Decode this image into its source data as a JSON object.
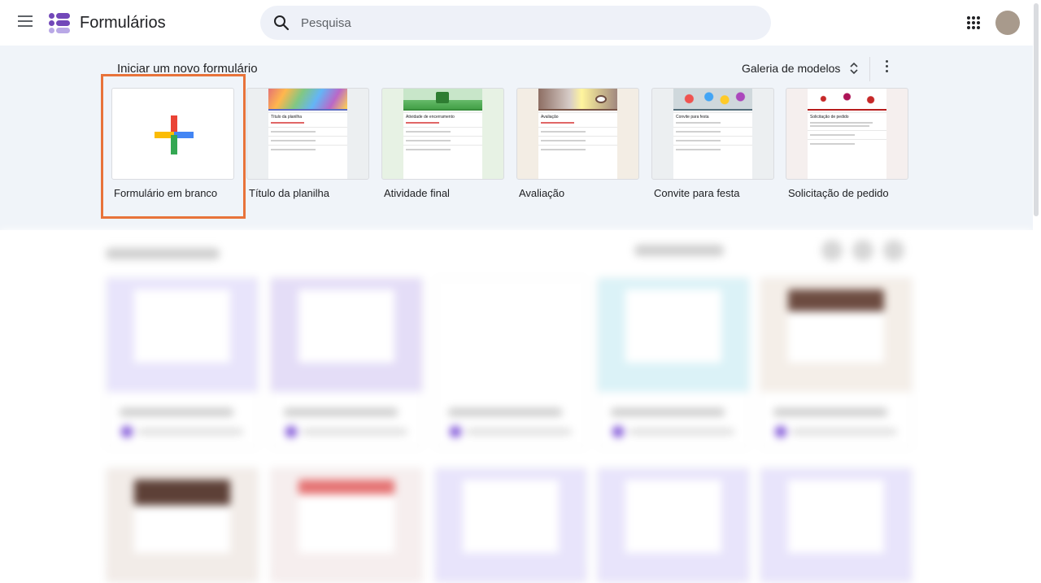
{
  "header": {
    "app_title": "Formulários",
    "search_placeholder": "Pesquisa"
  },
  "templates": {
    "section_title": "Iniciar um novo formulário",
    "gallery_label": "Galeria de modelos",
    "items": [
      {
        "label": "Formulário em branco"
      },
      {
        "label": "Título da planilha",
        "form_title": "Título da planilha"
      },
      {
        "label": "Atividade final",
        "form_title": "Atividade de encerramento"
      },
      {
        "label": "Avaliação",
        "form_title": "Avaliação"
      },
      {
        "label": "Convite para festa",
        "form_title": "Convite para festa"
      },
      {
        "label": "Solicitação de pedido",
        "form_title": "Solicitação de pedido"
      }
    ]
  },
  "colors": {
    "highlight": "#e8733a",
    "band_background": "#f0f4f9",
    "google_blue": "#4285f4",
    "google_red": "#ea4335",
    "google_yellow": "#fbbc04",
    "google_green": "#34a853",
    "forms_purple": "#7b4fd6"
  }
}
